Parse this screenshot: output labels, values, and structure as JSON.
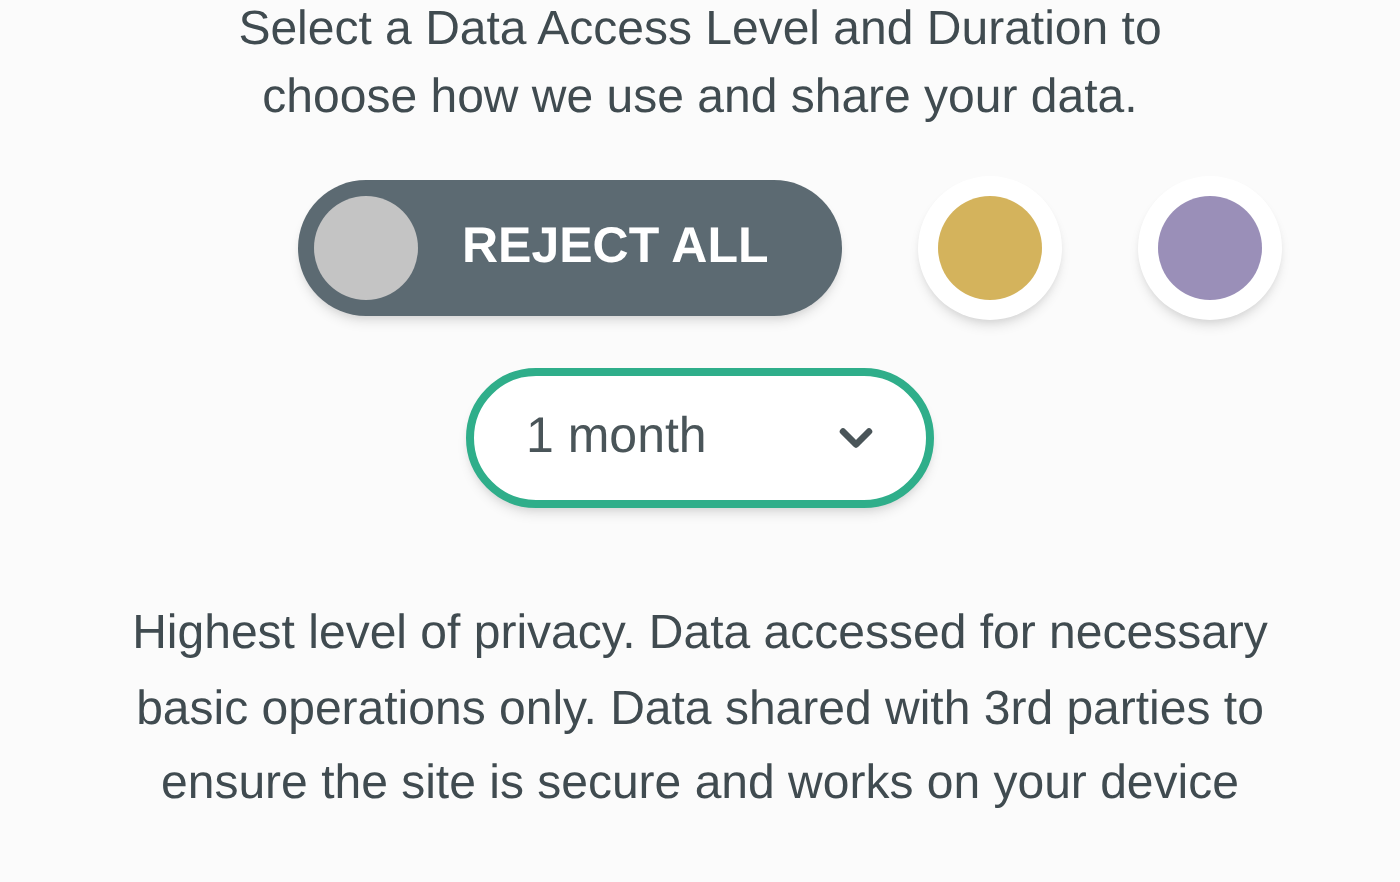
{
  "intro": [
    "Select a Data Access Level and Duration to",
    "choose how we use and share your data."
  ],
  "levels": [
    {
      "label": "REJECT ALL",
      "color": "#c4c4c4",
      "selected": true
    },
    {
      "color": "#d4b35c",
      "selected": false
    },
    {
      "color": "#9a8fb8",
      "selected": false
    }
  ],
  "duration": {
    "value": "1 month"
  },
  "description": "Highest level of privacy. Data accessed for necessary basic operations only. Data shared with 3rd parties to ensure the site is secure and works on your device"
}
